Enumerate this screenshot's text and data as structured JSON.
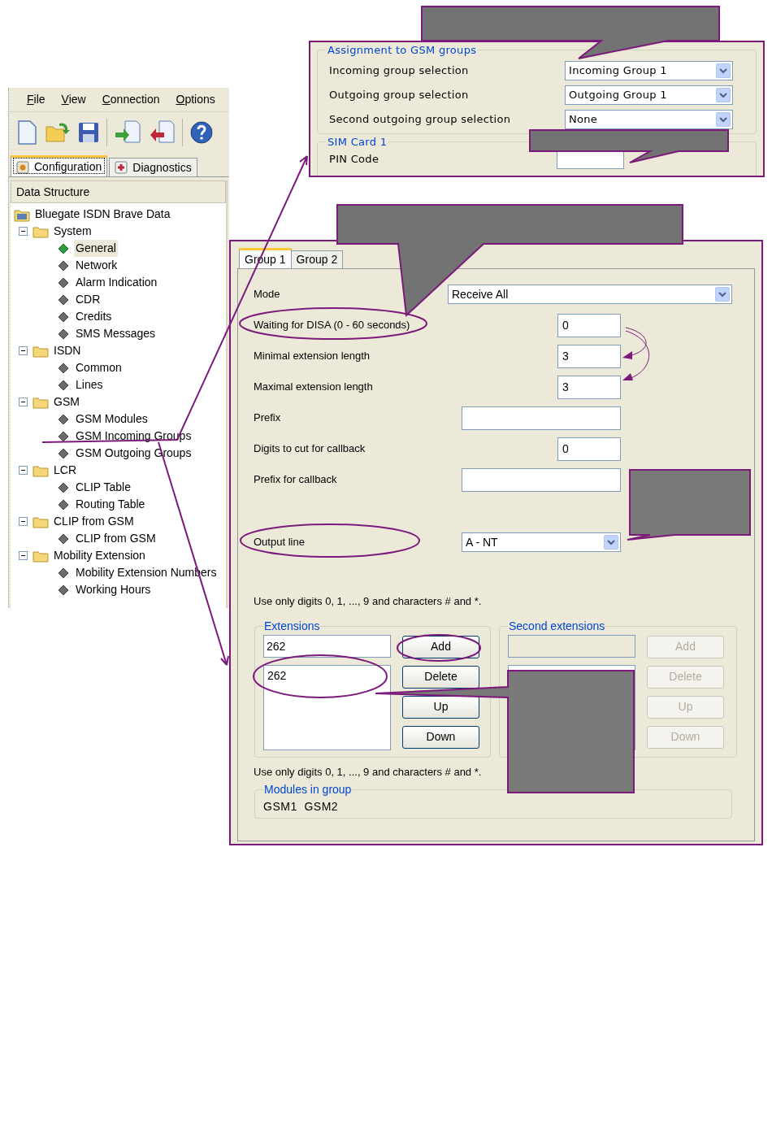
{
  "menu": [
    {
      "label": "File"
    },
    {
      "label": "View"
    },
    {
      "label": "Connection"
    },
    {
      "label": "Options"
    }
  ],
  "tabs": [
    {
      "label": "Configuration",
      "selected": true
    },
    {
      "label": "Diagnostics",
      "selected": false
    }
  ],
  "tree": {
    "header": "Data Structure",
    "root": {
      "label": "Bluegate ISDN Brave Data",
      "children": [
        {
          "label": "System",
          "expanded": true,
          "children": [
            {
              "label": "General",
              "selected": true
            },
            {
              "label": "Network",
              "selected": false
            },
            {
              "label": "Alarm Indication",
              "selected": false
            },
            {
              "label": "CDR",
              "selected": false
            },
            {
              "label": "Credits",
              "selected": false
            },
            {
              "label": "SMS Messages",
              "selected": false
            }
          ]
        },
        {
          "label": "ISDN",
          "expanded": true,
          "children": [
            {
              "label": "Common",
              "selected": false
            },
            {
              "label": "Lines",
              "selected": false
            }
          ]
        },
        {
          "label": "GSM",
          "expanded": true,
          "children": [
            {
              "label": "GSM Modules",
              "selected": false
            },
            {
              "label": "GSM Incoming Groups",
              "selected": false
            },
            {
              "label": "GSM Outgoing Groups",
              "selected": false
            }
          ]
        },
        {
          "label": "LCR",
          "expanded": true,
          "children": [
            {
              "label": "CLIP Table",
              "selected": false
            },
            {
              "label": "Routing Table",
              "selected": false
            }
          ]
        },
        {
          "label": "CLIP from GSM",
          "expanded": true,
          "children": [
            {
              "label": "CLIP from GSM",
              "selected": false
            }
          ]
        },
        {
          "label": "Mobility Extension",
          "expanded": true,
          "children": [
            {
              "label": "Mobility Extension Numbers",
              "selected": false
            },
            {
              "label": "Working Hours",
              "selected": false
            }
          ]
        }
      ]
    }
  },
  "assignment": {
    "title": "Assignment to GSM groups",
    "rows": [
      {
        "label": "Incoming group selection",
        "value": "Incoming Group 1"
      },
      {
        "label": "Outgoing group selection",
        "value": "Outgoing Group 1"
      },
      {
        "label": "Second outgoing group selection",
        "value": "None"
      }
    ]
  },
  "sim_card": {
    "title": "SIM Card 1",
    "pin_label": "PIN Code"
  },
  "group_tabs": [
    {
      "label": "Group 1",
      "selected": true
    },
    {
      "label": "Group 2",
      "selected": false
    }
  ],
  "fields": [
    {
      "kind": "select",
      "label": "Mode",
      "value": "Receive All"
    },
    {
      "kind": "number",
      "label": "Waiting for DISA (0 - 60 seconds)",
      "value": "0"
    },
    {
      "kind": "number",
      "label": "Minimal extension length",
      "value": "3"
    },
    {
      "kind": "number",
      "label": "Maximal extension length",
      "value": "3"
    },
    {
      "kind": "text",
      "label": "Prefix"
    },
    {
      "kind": "number",
      "label": "Digits to cut for callback",
      "value": "0"
    },
    {
      "kind": "text",
      "label": "Prefix for callback"
    },
    {
      "kind": "line_select",
      "label": "Output line",
      "value": "A - NT"
    }
  ],
  "note_top": "Use only digits 0, 1, ..., 9 and characters # and *.",
  "extensions": {
    "title": "Extensions",
    "value": "262",
    "items": [
      "262"
    ],
    "buttons": [
      {
        "label": "Add",
        "disabled": false
      },
      {
        "label": "Delete",
        "disabled": false
      },
      {
        "label": "Up",
        "disabled": false
      },
      {
        "label": "Down",
        "disabled": false
      }
    ]
  },
  "second_extensions": {
    "title": "Second extensions",
    "buttons": [
      {
        "label": "Add",
        "disabled": true
      },
      {
        "label": "Delete",
        "disabled": true
      },
      {
        "label": "Up",
        "disabled": true
      },
      {
        "label": "Down",
        "disabled": true
      }
    ]
  },
  "note_bottom": "Use only digits 0, 1, ..., 9 and characters # and *.",
  "modules": {
    "title": "Modules in group",
    "value": "GSM1  GSM2"
  }
}
